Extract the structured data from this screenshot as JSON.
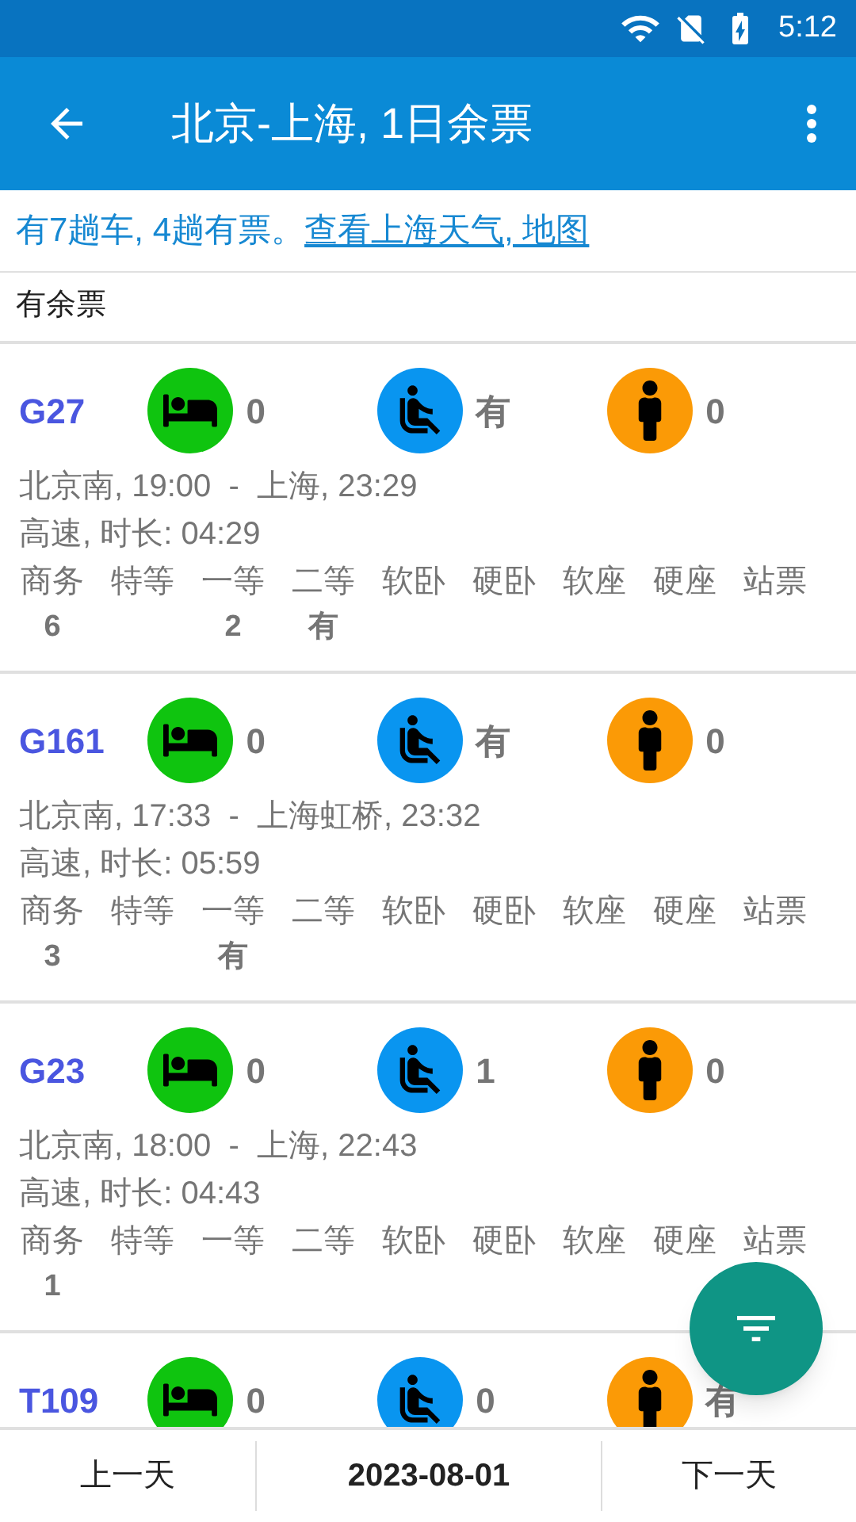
{
  "status_bar": {
    "time": "5:12"
  },
  "app_bar": {
    "title": "北京-上海, 1日余票"
  },
  "summary": {
    "text": "有7趟车, 4趟有票。",
    "link": "查看上海天气, 地图"
  },
  "filter_label": "有余票",
  "trains": [
    {
      "number": "G27",
      "sleeper": "0",
      "seat": "有",
      "standing": "0",
      "route": "北京南, 19:00  -  上海, 23:29",
      "info": "高速, 时长: 04:29",
      "classes": [
        {
          "label": "商务",
          "count": "6"
        },
        {
          "label": "特等"
        },
        {
          "label": "一等",
          "count": "2"
        },
        {
          "label": "二等",
          "count": "有"
        },
        {
          "label": "软卧"
        },
        {
          "label": "硬卧"
        },
        {
          "label": "软座"
        },
        {
          "label": "硬座"
        },
        {
          "label": "站票"
        }
      ]
    },
    {
      "number": "G161",
      "sleeper": "0",
      "seat": "有",
      "standing": "0",
      "route": "北京南, 17:33  -  上海虹桥, 23:32",
      "info": "高速, 时长: 05:59",
      "classes": [
        {
          "label": "商务",
          "count": "3"
        },
        {
          "label": "特等"
        },
        {
          "label": "一等",
          "count": "有"
        },
        {
          "label": "二等"
        },
        {
          "label": "软卧"
        },
        {
          "label": "硬卧"
        },
        {
          "label": "软座"
        },
        {
          "label": "硬座"
        },
        {
          "label": "站票"
        }
      ]
    },
    {
      "number": "G23",
      "sleeper": "0",
      "seat": "1",
      "standing": "0",
      "route": "北京南, 18:00  -  上海, 22:43",
      "info": "高速, 时长: 04:43",
      "classes": [
        {
          "label": "商务",
          "count": "1"
        },
        {
          "label": "特等"
        },
        {
          "label": "一等"
        },
        {
          "label": "二等"
        },
        {
          "label": "软卧"
        },
        {
          "label": "硬卧"
        },
        {
          "label": "软座"
        },
        {
          "label": "硬座"
        },
        {
          "label": "站票"
        }
      ]
    },
    {
      "number": "T109",
      "sleeper": "0",
      "seat": "0",
      "standing": "有"
    }
  ],
  "bottom_bar": {
    "prev": "上一天",
    "date": "2023-08-01",
    "next": "下一天"
  }
}
